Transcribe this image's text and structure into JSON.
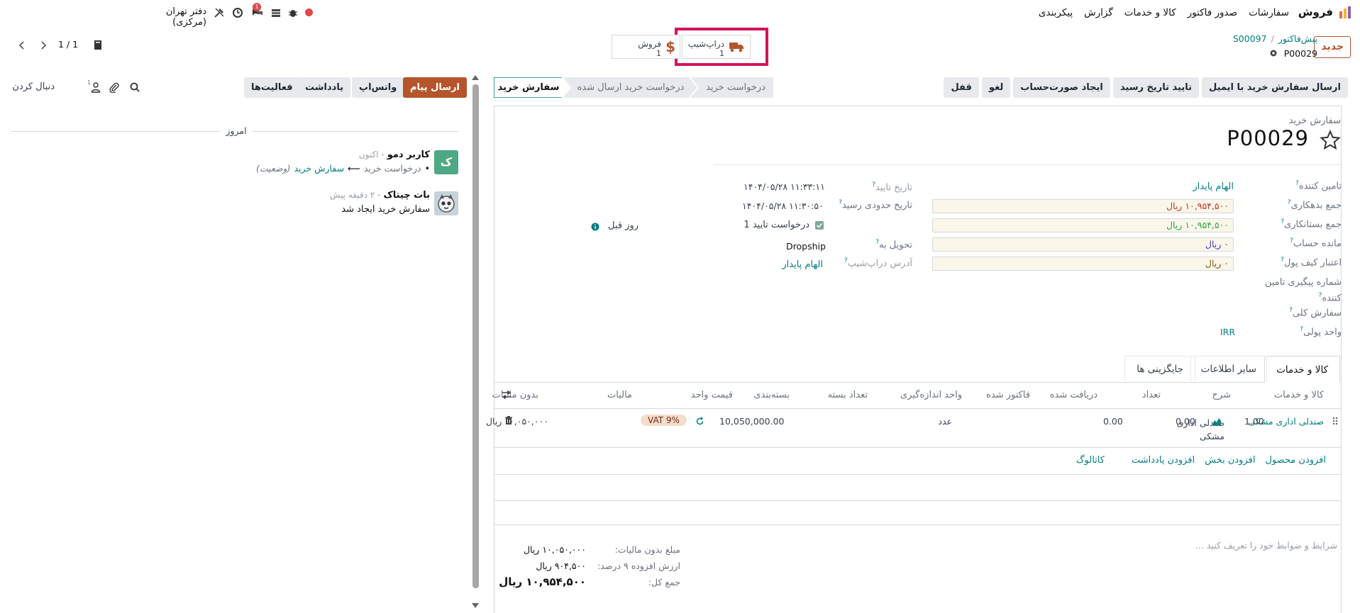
{
  "topbar": {
    "app_name": "فروش",
    "menu": [
      "سفارشات",
      "صدور فاکتور",
      "کالا و خدمات",
      "گزارش",
      "پیکربندی"
    ],
    "company": "دفتر تهران (مرکزی)",
    "chat_badge": "1",
    "colors": {
      "record_dot": "#e04848",
      "badge": "#e04848"
    }
  },
  "control": {
    "new_button": "جدید",
    "breadcrumb_parent": "پیش‌فاکتور",
    "breadcrumb_sep": "/",
    "breadcrumb_link": "S00097",
    "record_title": "P00029",
    "pager": "1 / 1",
    "smart_buttons": {
      "dropship": {
        "label": "دراپ‌شیپ",
        "count": "1"
      },
      "sale": {
        "label": "فروش",
        "count": "1"
      }
    }
  },
  "actions": {
    "buttons": [
      "ارسال سفارش خرید با ایمیل",
      "تایید تاریخ رسید",
      "ایجاد صورت‌حساب",
      "لغو",
      "قفل"
    ],
    "stages": [
      "درخواست خرید",
      "درخواست خرید ارسال شده",
      "سفارش خرید"
    ],
    "active_stage": "سفارش خرید"
  },
  "form": {
    "record_type": "سفارش خرید",
    "name": "P00029",
    "left_fields": [
      {
        "label": "تامین کننده",
        "value": "الهام پایدار",
        "kind": "link"
      },
      {
        "label": "جمع بدهکاری",
        "value": "۱۰,۹۵۴,۵۰۰ ریال",
        "kind": "money-red"
      },
      {
        "label": "جمع بستانکاری",
        "value": "۱۰,۹۵۴,۵۰۰ ریال",
        "kind": "money-green"
      },
      {
        "label": "مانده حساب",
        "value": "۰ ریال",
        "kind": "money-blue"
      },
      {
        "label": "اعتبار کیف پول",
        "value": "۰ ریال",
        "kind": "money-plain"
      },
      {
        "label": "شماره پیگیری تامین کننده",
        "value": "",
        "kind": "text"
      },
      {
        "label": "سفارش کلی",
        "value": "",
        "kind": "text"
      },
      {
        "label": "واحد پولی",
        "value": "IRR",
        "kind": "link"
      }
    ],
    "right_fields": {
      "confirm_date_label": "تاریخ تایید",
      "confirm_date_value": "۱۴۰۴/۰۵/۲۸ ۱۱:۳۳:۱۱",
      "expected_date_label": "تاریخ حدودی رسید",
      "expected_date_value": "۱۴۰۴/۰۵/۲۸ ۱۱:۳۰:۵۰",
      "ask_confirm_label": "درخواست تایید",
      "ask_confirm_days": "1",
      "days_before": "روز قبل",
      "deliver_to_label": "تحویل به",
      "deliver_to_value": "Dropship",
      "dropship_addr_label": "آدرس دراپ‌شیپ",
      "dropship_addr_value": "الهام پایدار"
    }
  },
  "tabs": [
    "کالا و خدمات",
    "سایر اطلاعات",
    "جایگزینی ها"
  ],
  "lines": {
    "headers": [
      "کالا و خدمات",
      "شرح",
      "تعداد",
      "دریافت شده",
      "فاکتور شده",
      "واحد اندازه‌گیری",
      "تعداد بسته",
      "بسته‌بندی",
      "قیمت واحد",
      "مالیات",
      "بدون مالیات"
    ],
    "rows": [
      {
        "product": "صندلی اداری مشکی",
        "description_1": "صندلی اداری",
        "description_2": "مشکی",
        "qty": "1.00",
        "received": "0.00",
        "invoiced": "0.00",
        "uom": "عدد",
        "price": "10,050,000.00",
        "tax": "VAT 9%",
        "subtotal": "۱۰,۰۵۰,۰۰۰ ریال"
      }
    ],
    "add_links": [
      "افزودن محصول",
      "افزودن بخش",
      "افزودن یادداشت",
      "کاتالوگ"
    ]
  },
  "terms_placeholder": "شرایط و ضوابط خود را تعریف کنید ...",
  "totals": {
    "untaxed_label": "مبلغ بدون مالیات:",
    "untaxed_value": "۱۰,۰۵۰,۰۰۰ ریال",
    "vat_label": "ارزش افزوده ۹ درصد:",
    "vat_value": "۹۰۴,۵۰۰ ریال",
    "total_label": "جمع کل:",
    "total_value": "۱۰,۹۵۴,۵۰۰ ریال"
  },
  "chatter": {
    "send_message": "ارسال پیام",
    "whatsapp": "واتس‌اپ",
    "note": "یادداشت",
    "activities": "فعالیت‌ها",
    "follow": "دنبال کردن",
    "followers_count": "1",
    "today": "امروز",
    "messages": [
      {
        "avatar_letter": "ک",
        "author": "کاربر دمو",
        "time": "- اکنون",
        "change_from": "درخواست خرید",
        "arrow": "⟵",
        "change_to": "سفارش خرید",
        "change_field": "(وضعیت)"
      },
      {
        "author": "بات چیتاک",
        "time": "- ۲ دقیقه پیش",
        "body": "سفارش خرید ایجاد شد"
      }
    ]
  },
  "colors": {
    "primary": "#b5552b",
    "accent": "#017e84",
    "highlight": "#d3145a"
  }
}
